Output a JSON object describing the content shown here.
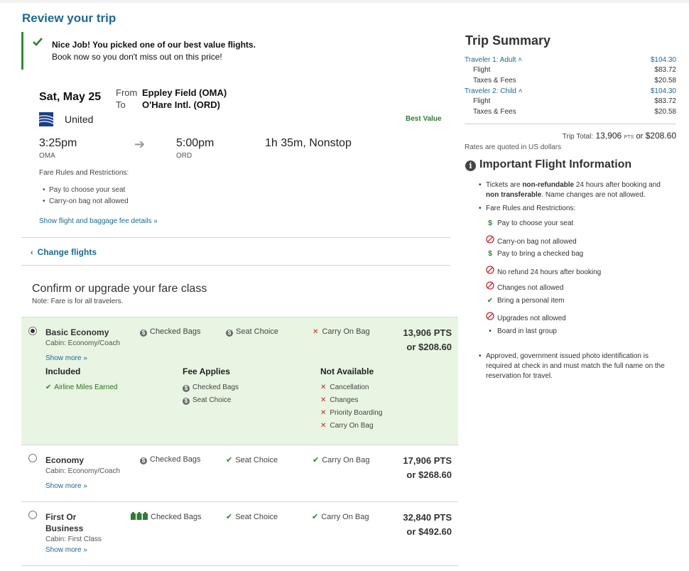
{
  "page_title": "Review your trip",
  "banner": {
    "headline": "Nice Job! You picked one of our best value flights.",
    "subtext": "Book now so you don't miss out on this price!"
  },
  "flight": {
    "date": "Sat, May 25",
    "from_label": "From",
    "to_label": "To",
    "from_airport": "Eppley Field (OMA)",
    "to_airport": "O'Hare Intl. (ORD)",
    "airline": "United",
    "badge": "Best Value",
    "depart_time": "3:25pm",
    "depart_code": "OMA",
    "arrive_time": "5:00pm",
    "arrive_code": "ORD",
    "duration": "1h 35m, Nonstop",
    "rules_heading": "Fare Rules and Restrictions:",
    "rules": [
      "Pay to choose your seat",
      "Carry-on bag not allowed"
    ],
    "details_link": "Show flight and baggage fee details »"
  },
  "change_flights": "Change flights",
  "fare_section": {
    "title": "Confirm or upgrade your fare class",
    "note": "Note: Fare is for all travelers."
  },
  "fares": [
    {
      "name": "Basic Economy",
      "cabin": "Cabin: Economy/Coach",
      "show_more": "Show more »",
      "features": [
        "Checked Bags",
        "Seat Choice",
        "Carry On Bag"
      ],
      "points": "13,906 PTS",
      "cash": "or $208.60",
      "included_h": "Included",
      "fee_h": "Fee Applies",
      "na_h": "Not Available",
      "included": [
        "Airline Miles Earned"
      ],
      "fee": [
        "Checked Bags",
        "Seat Choice"
      ],
      "na": [
        "Cancellation",
        "Changes",
        "Priority Boarding",
        "Carry On Bag"
      ]
    },
    {
      "name": "Economy",
      "cabin": "Cabin: Economy/Coach",
      "show_more": "Show more »",
      "features": [
        "Checked Bags",
        "Seat Choice",
        "Carry On Bag"
      ],
      "points": "17,906 PTS",
      "cash": "or $268.60"
    },
    {
      "name_line1": "First Or",
      "name_line2": "Business",
      "cabin": "Cabin: First Class",
      "show_more": "Show more »",
      "features": [
        "Checked Bags",
        "Seat Choice",
        "Carry On Bag"
      ],
      "points": "32,840 PTS",
      "cash": "or $492.60"
    }
  ],
  "summary": {
    "title": "Trip Summary",
    "traveler1": "Traveler 1: Adult ˄",
    "traveler1_total": "$104.30",
    "traveler2": "Traveler 2: Child ˄",
    "traveler2_total": "$104.30",
    "flight_label": "Flight",
    "flight_amount": "$83.72",
    "taxes_label": "Taxes & Fees",
    "taxes_amount": "$20.58",
    "total_label": "Trip Total:",
    "total_points": "13,906",
    "pts_small": "PTS",
    "or": "or",
    "total_cash": "$208.60",
    "usd_note": "Rates are quoted in US dollars"
  },
  "info": {
    "title": "Important Flight Information",
    "ticket_pre": "Tickets are ",
    "ticket_b1": "non-refundable",
    "ticket_mid": " 24 hours after booking and",
    "ticket_b2": "non transferable",
    "ticket_post": ". Name changes are not allowed.",
    "rules_heading": "Fare Rules and Restrictions:",
    "rules": [
      "Pay to choose your seat",
      "Carry-on bag not allowed",
      "Pay to bring a checked bag",
      "No refund 24 hours after booking",
      "Changes not allowed",
      "Bring a personal item",
      "Upgrades not allowed",
      "Board in last group"
    ],
    "id_line1": "Approved, government issued photo identification is",
    "id_line2": "required at check in and must match the full name on the",
    "id_line3": "reservation for travel."
  },
  "colors": {
    "link": "#1b6a94",
    "selected_bg": "#e8f5e2",
    "green": "#2e7d32",
    "red": "#c62828"
  }
}
